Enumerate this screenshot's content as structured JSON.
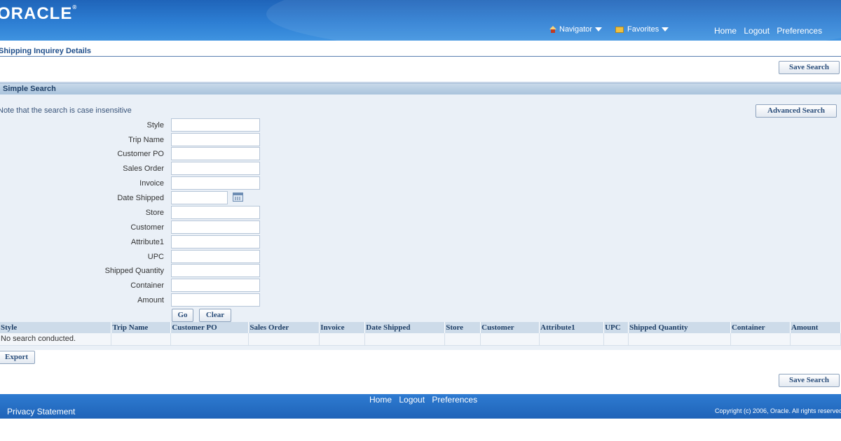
{
  "header": {
    "logo": "ORACLE",
    "navigator_label": "Navigator",
    "favorites_label": "Favorites",
    "links": [
      "Home",
      "Logout",
      "Preferences"
    ]
  },
  "page": {
    "title": "Shipping Inquirey Details",
    "save_search_label": "Save Search"
  },
  "search": {
    "section_title": "Simple Search",
    "note": "Note that the search is case insensitive",
    "advanced_search_label": "Advanced Search",
    "fields": [
      {
        "label": "Style",
        "value": ""
      },
      {
        "label": "Trip Name",
        "value": ""
      },
      {
        "label": "Customer PO",
        "value": ""
      },
      {
        "label": "Sales Order",
        "value": ""
      },
      {
        "label": "Invoice",
        "value": ""
      },
      {
        "label": "Date Shipped",
        "value": ""
      },
      {
        "label": "Store",
        "value": ""
      },
      {
        "label": "Customer",
        "value": ""
      },
      {
        "label": "Attribute1",
        "value": ""
      },
      {
        "label": "UPC",
        "value": ""
      },
      {
        "label": "Shipped Quantity",
        "value": ""
      },
      {
        "label": "Container",
        "value": ""
      },
      {
        "label": "Amount",
        "value": ""
      }
    ],
    "go_label": "Go",
    "clear_label": "Clear"
  },
  "results": {
    "columns": [
      "Style",
      "Trip Name",
      "Customer PO",
      "Sales Order",
      "Invoice",
      "Date Shipped",
      "Store",
      "Customer",
      "Attribute1",
      "UPC",
      "Shipped Quantity",
      "Container",
      "Amount"
    ],
    "empty_message": "No search conducted."
  },
  "export_label": "Export",
  "footer": {
    "links": [
      "Home",
      "Logout",
      "Preferences"
    ],
    "privacy": "Privacy Statement",
    "copyright": "Copyright (c) 2006, Oracle. All rights reserved."
  },
  "colors": {
    "header_blue": "#2d7ed3",
    "section_blue": "#a9c3dc",
    "label_blue": "#1f3f66"
  },
  "icons": [
    "home-icon",
    "chevron-down-icon",
    "favorites-icon",
    "calendar-icon"
  ]
}
